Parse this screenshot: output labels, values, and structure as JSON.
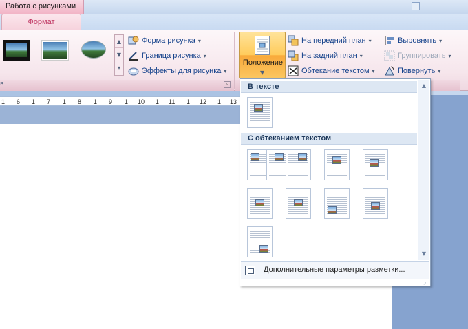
{
  "titlebar": {
    "context_group": "Работа с рисунками"
  },
  "tabs": {
    "active": "Формат"
  },
  "ribbon": {
    "picture_styles_group_letter": "в",
    "shape_commands": [
      {
        "label": "Форма рисунка",
        "icon": "picture-shape-icon"
      },
      {
        "label": "Граница рисунка",
        "icon": "picture-border-icon"
      },
      {
        "label": "Эффекты для рисунка",
        "icon": "picture-effects-icon"
      }
    ],
    "position_button": {
      "label": "Положение",
      "arrow": "▼"
    },
    "arrange_commands_left": [
      {
        "label": "На передний план",
        "icon": "bring-to-front-icon"
      },
      {
        "label": "На задний план",
        "icon": "send-to-back-icon"
      },
      {
        "label": "Обтекание текстом",
        "icon": "text-wrap-icon"
      }
    ],
    "arrange_commands_right": [
      {
        "label": "Выровнять",
        "icon": "align-icon",
        "disabled": false
      },
      {
        "label": "Группировать",
        "icon": "group-icon",
        "disabled": true
      },
      {
        "label": "Повернуть",
        "icon": "rotate-icon",
        "disabled": false
      }
    ],
    "dropdown_arrow": "▾"
  },
  "ruler": {
    "ticks": [
      "1",
      "6",
      "1",
      "7",
      "1",
      "8",
      "1",
      "9",
      "1",
      "10",
      "1",
      "11",
      "1",
      "12",
      "1",
      "13"
    ]
  },
  "position_menu": {
    "section_inline": "В тексте",
    "section_wrap": "С обтеканием текстом",
    "footer_label": "Дополнительные параметры разметки..."
  },
  "colors": {
    "accent_tab": "#c13a65",
    "ribbon_text": "#15428b",
    "highlight": "#ffcb5b"
  }
}
